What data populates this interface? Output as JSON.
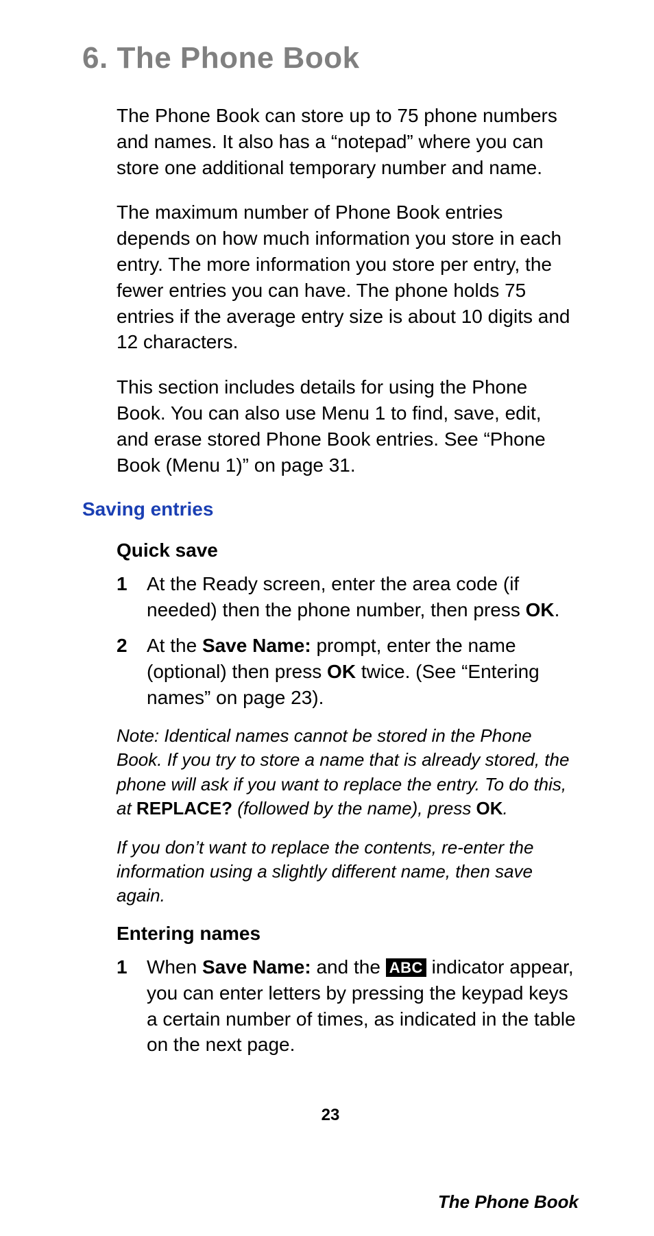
{
  "chapter": {
    "number": "6.",
    "title": "The Phone Book"
  },
  "intro": {
    "p1": "The Phone Book can store up to 75 phone numbers and names. It also has a “notepad” where you can store one additional temporary number and name.",
    "p2": "The maximum number of Phone Book entries depends on how much information you store in each entry. The more information you store per entry, the fewer entries you can have. The phone holds 75 entries if the average entry size is about 10 digits and 12 characters.",
    "p3": "This section includes details for using the Phone Book. You can also use Menu 1 to find, save, edit, and erase stored Phone Book entries. See “Phone Book (Menu 1)” on page 31."
  },
  "section": {
    "heading": "Saving entries",
    "quick_save": {
      "heading": "Quick save",
      "steps": [
        {
          "n": "1",
          "pre": "At the Ready screen, enter the area code (if needed) then the phone number, then press ",
          "bold": "OK",
          "post": "."
        },
        {
          "n": "2",
          "pre": "At the ",
          "bold1": "Save Name:",
          "mid": " prompt, enter the name (optional) then press ",
          "bold2": "OK",
          "post": " twice. (See “Entering names” on page 23)."
        }
      ],
      "note1_pre": "Note: Identical names cannot be stored in the Phone Book. If you try to store a name that is already stored, the phone will ask if you want to replace the entry. To do this, at ",
      "note1_bold1": "REPLACE?",
      "note1_mid": " (followed by the name), press ",
      "note1_bold2": "OK",
      "note1_post": ".",
      "note2": "If you don’t want to replace the contents, re-enter the information using a slightly different name, then save again."
    },
    "entering_names": {
      "heading": "Entering names",
      "step": {
        "n": "1",
        "pre": "When ",
        "bold": "Save Name:",
        "mid": " and the ",
        "badge": "ABC",
        "post": " indicator appear, you can enter letters by pressing the keypad keys a certain number of times, as indicated in the table on the next page."
      }
    }
  },
  "page_number": "23",
  "footer_title": "The Phone Book"
}
